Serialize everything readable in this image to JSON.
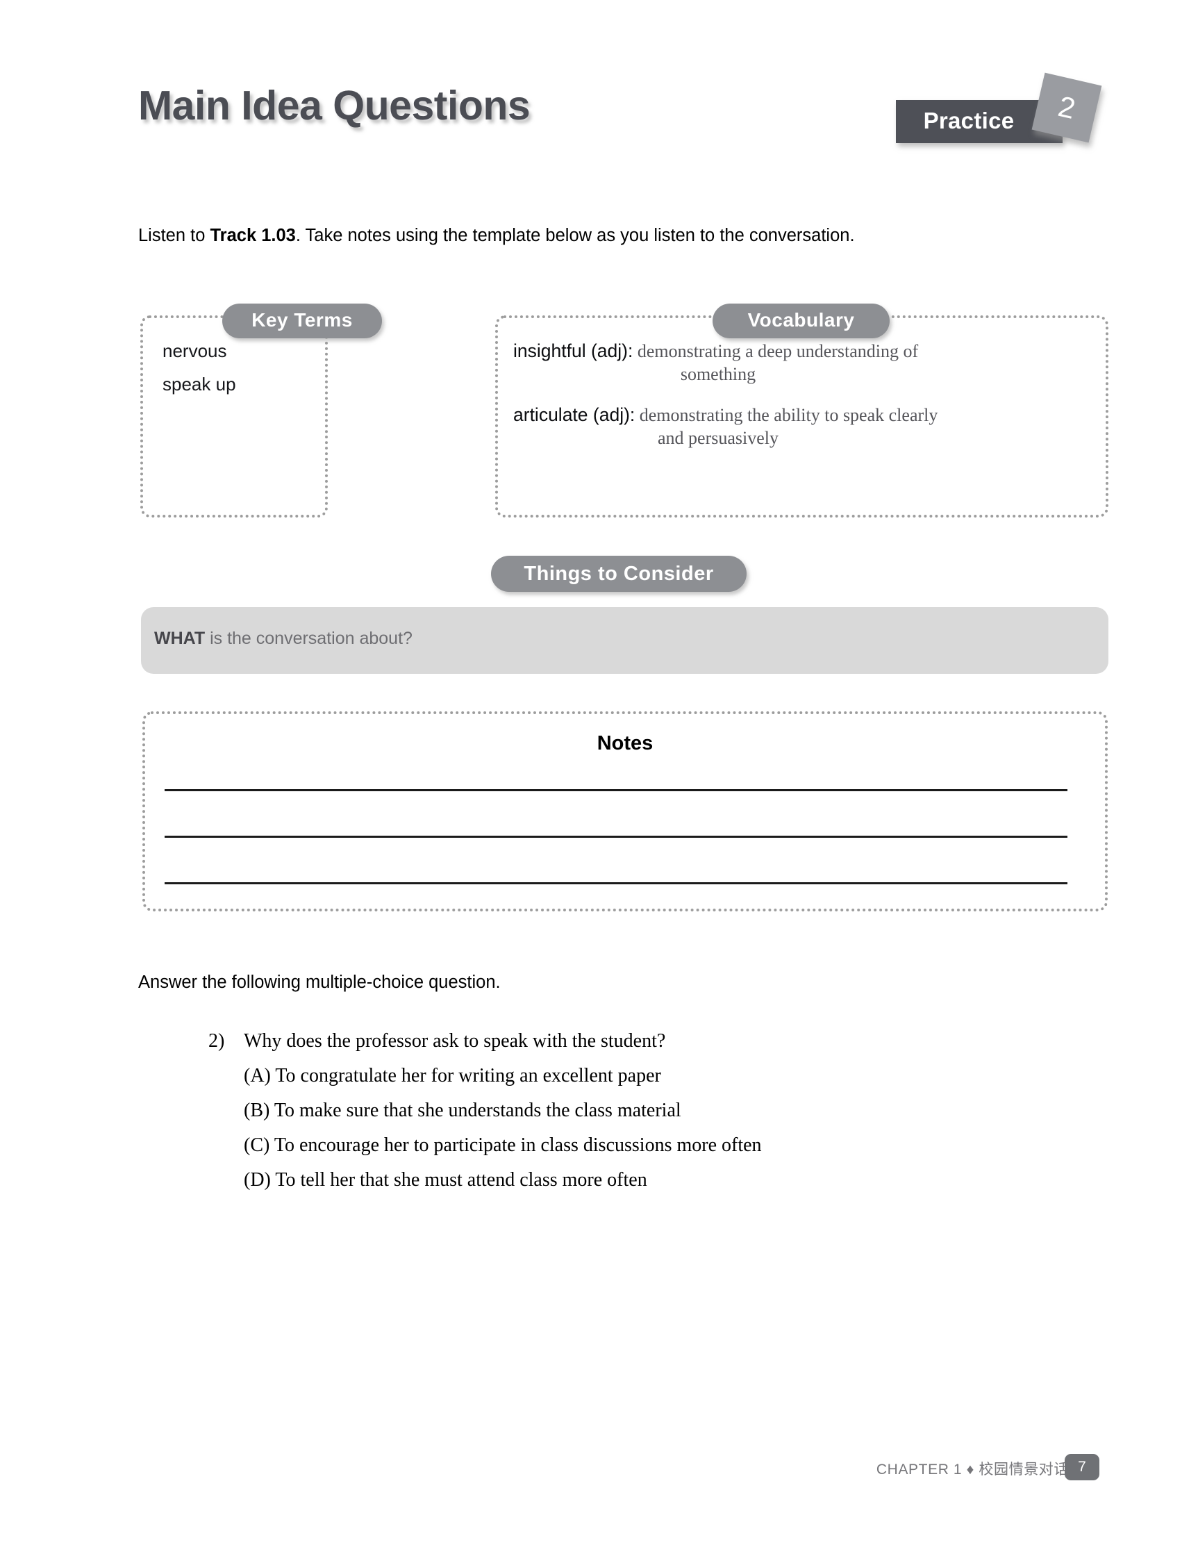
{
  "header": {
    "title": "Main Idea Questions",
    "practice_label": "Practice",
    "practice_number": "2"
  },
  "instructions": {
    "listen_prefix": "Listen to ",
    "listen_track": "Track 1.03",
    "listen_suffix": ". Take notes using the template below as you listen to the conversation.",
    "answer": "Answer the following multiple-choice question."
  },
  "key_terms": {
    "label": "Key Terms",
    "items": [
      "nervous",
      "speak up"
    ]
  },
  "vocabulary": {
    "label": "Vocabulary",
    "entries": [
      {
        "word": "insightful (adj):",
        "definition": " demonstrating a deep understanding of",
        "continuation": "something"
      },
      {
        "word": "articulate (adj):",
        "definition": " demonstrating the ability to speak clearly",
        "continuation": "and persuasively"
      }
    ]
  },
  "things_to_consider": {
    "label": "Things to Consider",
    "prompt_bold": "WHAT",
    "prompt_rest": " is the conversation about?"
  },
  "notes": {
    "title": "Notes",
    "line_count": 3
  },
  "question": {
    "number": "2)",
    "stem": "Why does the professor ask to speak with the student?",
    "options": [
      "(A) To congratulate her for writing an excellent paper",
      "(B) To make sure that she understands the class material",
      "(C) To encourage her to participate in class discussions more often",
      "(D) To tell her that she must attend class more often"
    ]
  },
  "footer": {
    "chapter": "CHAPTER 1",
    "separator": "♦",
    "chapter_title": "校园情景对话",
    "page_number": "7"
  },
  "colors": {
    "title_gray": "#4b4d54",
    "badge_dark": "#4e5057",
    "badge_light": "#9a9ca1",
    "pill_gray": "#8d8f93",
    "box_gray": "#d9d9d9",
    "dotted_border": "#9d9d9d"
  }
}
